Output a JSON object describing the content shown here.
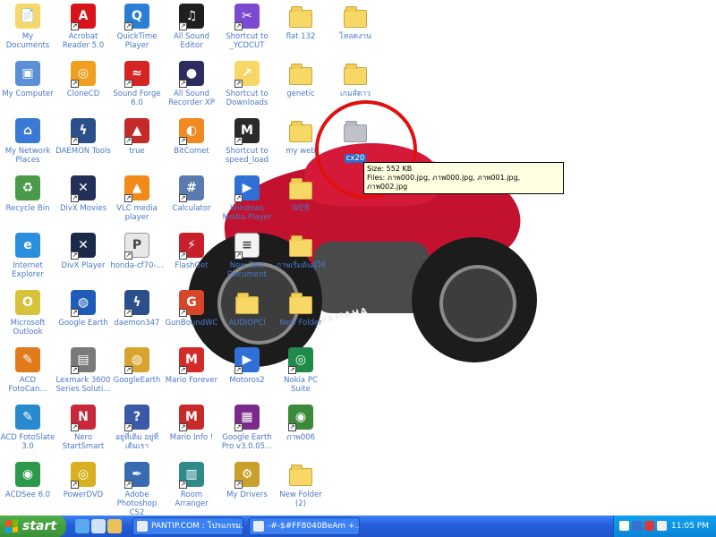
{
  "desktop": {
    "icons": [
      {
        "label": "My Documents",
        "icon": "my-documents-icon"
      },
      {
        "label": "Acrobat Reader 5.0",
        "icon": "acrobat-icon"
      },
      {
        "label": "QuickTime Player",
        "icon": "quicktime-icon"
      },
      {
        "label": "All Sound Editor",
        "icon": "sound-editor-icon"
      },
      {
        "label": "Shortcut to _YCDCUT",
        "icon": "shortcut-icon"
      },
      {
        "label": "flat 132",
        "icon": "folder-icon"
      },
      {
        "label": "โหลดงาน",
        "icon": "folder-icon"
      },
      {
        "label": "My Computer",
        "icon": "my-computer-icon"
      },
      {
        "label": "CloneCD",
        "icon": "clonecd-icon"
      },
      {
        "label": "Sound Forge 6.0",
        "icon": "sound-forge-icon"
      },
      {
        "label": "All Sound Recorder XP",
        "icon": "sound-recorder-icon"
      },
      {
        "label": "Shortcut to Downloads",
        "icon": "folder-shortcut-icon"
      },
      {
        "label": "genetic",
        "icon": "folder-icon"
      },
      {
        "label": "เกมส์ดาว",
        "icon": "folder-icon"
      },
      {
        "label": "My Network Places",
        "icon": "network-places-icon"
      },
      {
        "label": "DAEMON Tools",
        "icon": "daemon-tools-icon"
      },
      {
        "label": "true",
        "icon": "true-icon"
      },
      {
        "label": "BitComet",
        "icon": "bitcomet-icon"
      },
      {
        "label": "Shortcut to speed_load",
        "icon": "speed-load-icon"
      },
      {
        "label": "my web",
        "icon": "folder-icon"
      },
      {
        "label": "cx20",
        "icon": "folder-gray-icon",
        "selected": true
      },
      {
        "label": "Recycle Bin",
        "icon": "recycle-bin-icon"
      },
      {
        "label": "DivX Movies",
        "icon": "divx-movies-icon"
      },
      {
        "label": "VLC media player",
        "icon": "vlc-icon"
      },
      {
        "label": "Calculator",
        "icon": "calculator-icon"
      },
      {
        "label": "Windows Media Player",
        "icon": "media-player-icon"
      },
      {
        "label": "WEB",
        "icon": "folder-icon"
      },
      {
        "label": "Internet Explorer",
        "icon": "internet-explorer-icon"
      },
      {
        "label": "DivX Player",
        "icon": "divx-player-icon"
      },
      {
        "label": "honda-cf70-...",
        "icon": "pdf-icon"
      },
      {
        "label": "FlashGet",
        "icon": "flashget-icon"
      },
      {
        "label": "New Text Document",
        "icon": "text-document-icon"
      },
      {
        "label": "ภาพเริ่มต้นผู้ใช้",
        "icon": "folder-icon"
      },
      {
        "label": "Microsoft Outlook",
        "icon": "outlook-icon"
      },
      {
        "label": "Google Earth",
        "icon": "google-earth-icon"
      },
      {
        "label": "daemon347",
        "icon": "daemon-icon"
      },
      {
        "label": "GunBoundWC",
        "icon": "gunbound-icon"
      },
      {
        "label": "AUDIOPCI",
        "icon": "folder-icon"
      },
      {
        "label": "New Folder",
        "icon": "folder-icon"
      },
      {
        "label": "ACD FotoCan...",
        "icon": "acd-fotocanvas-icon"
      },
      {
        "label": "Lexmark 3600 Series Soluti...",
        "icon": "lexmark-icon"
      },
      {
        "label": "GoogleEarth",
        "icon": "googleearth-box-icon"
      },
      {
        "label": "Mario Forever",
        "icon": "mario-forever-icon"
      },
      {
        "label": "Motoros2",
        "icon": "motoros-icon"
      },
      {
        "label": "Nokia PC Suite",
        "icon": "nokia-icon"
      },
      {
        "label": "ACD FotoSlate 3.0",
        "icon": "acd-fotoslate-icon"
      },
      {
        "label": "Nero StartSmart",
        "icon": "nero-icon"
      },
      {
        "label": "อยู่ที่เดิม อยู่ที่เดิมเรา",
        "icon": "quest-icon"
      },
      {
        "label": "Mario Info !",
        "icon": "mario-info-icon"
      },
      {
        "label": "Google Earth Pro v3.0.05...",
        "icon": "winrar-icon"
      },
      {
        "label": "ภาพ006",
        "icon": "image-file-icon"
      },
      {
        "label": "ACDSee 6.0",
        "icon": "acdsee-icon"
      },
      {
        "label": "PowerDVD",
        "icon": "powerdvd-icon"
      },
      {
        "label": "Adobe Photoshop CS2",
        "icon": "photoshop-icon"
      },
      {
        "label": "Room Arranger",
        "icon": "room-arranger-icon"
      },
      {
        "label": "My Drivers",
        "icon": "my-drivers-icon"
      },
      {
        "label": "New Folder (2)",
        "icon": "folder-icon"
      }
    ],
    "wallpaper_text": "YAMAHA"
  },
  "tooltip": {
    "size_line": "Size: 552 KB",
    "files_line": "Files: ภาพ000.jpg, ภาพ000.jpg, ภาพ001.jpg, ภาพ002.jpg"
  },
  "taskbar": {
    "start_label": "start",
    "buttons": [
      {
        "label": "PANTIP.COM : โปรแกรม..."
      },
      {
        "label": "-#-$#FF8040BeAm +..."
      }
    ],
    "clock": "11:05 PM"
  },
  "colors": {
    "taskbar_blue": "#245edb",
    "start_green": "#3b8f37",
    "selection_blue": "#316ac5",
    "annotation_red": "#e01010",
    "tooltip_bg": "#ffffe1"
  }
}
